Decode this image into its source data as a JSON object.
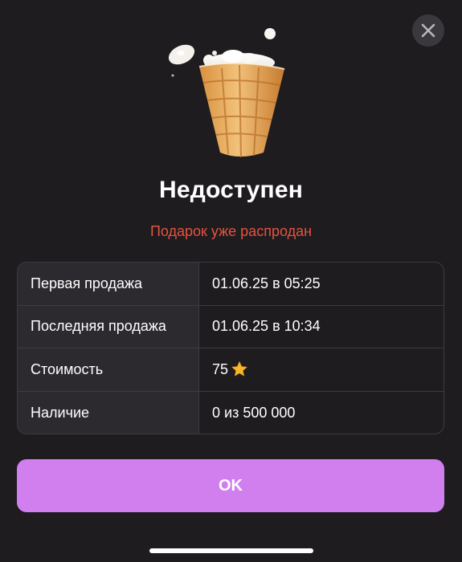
{
  "dialog": {
    "title": "Недоступен",
    "subtitle": "Подарок уже распродан",
    "ok_label": "OK"
  },
  "info": [
    {
      "label": "Первая продажа",
      "value": "01.06.25 в 05:25"
    },
    {
      "label": "Последняя продажа",
      "value": "01.06.25 в 10:34"
    },
    {
      "label": "Стоимость",
      "value": "75"
    },
    {
      "label": "Наличие",
      "value": "0 из 500 000"
    }
  ],
  "icons": {
    "close": "close-icon",
    "gift": "ice-cream-cone-icon",
    "price": "star-icon"
  },
  "colors": {
    "background": "#1e1c1f",
    "subtitle": "#e5533f",
    "button": "#d17fef",
    "star": "#f5b82a"
  }
}
